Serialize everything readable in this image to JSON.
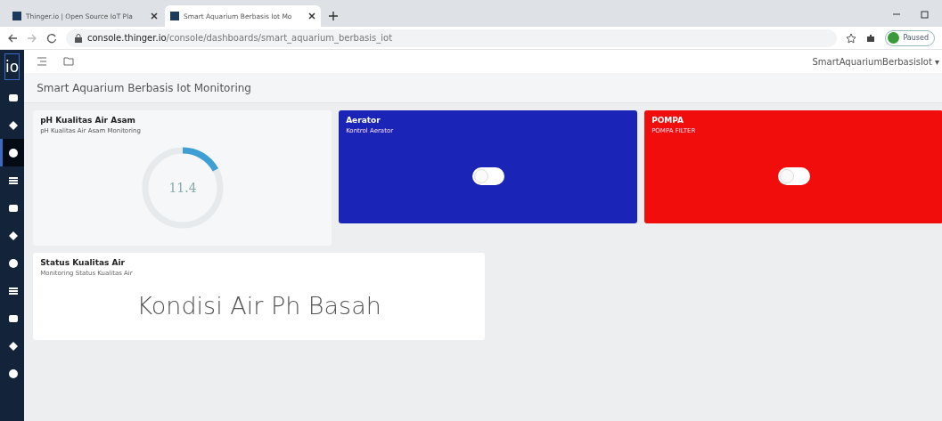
{
  "browser": {
    "tabs": [
      {
        "label": "Thinger.io | Open Source IoT Pla",
        "selected": false
      },
      {
        "label": "Smart Aquarium Berbasis Iot Mo",
        "selected": true
      }
    ],
    "url_host": "console.thinger.io",
    "url_path": "/console/dashboards/smart_aquarium_berbasis_iot",
    "profile_status": "Paused"
  },
  "app": {
    "logo": "io",
    "user": "SmartAquariumBerbasisIot",
    "user_caret": "▾",
    "dashboard_title": "Smart Aquarium Berbasis Iot Monitoring",
    "sidebar": [
      {
        "selected": false
      },
      {
        "selected": false
      },
      {
        "selected": true
      },
      {
        "selected": false
      },
      {
        "selected": false
      },
      {
        "selected": false
      },
      {
        "selected": false
      },
      {
        "selected": false
      },
      {
        "selected": false
      },
      {
        "selected": false
      },
      {
        "selected": false
      }
    ],
    "gauge": {
      "title": "pH Kualitas Air Asam",
      "subtitle": "pH Kualitas Air Asam Monitoring",
      "value": "11.4",
      "level": 0.17
    },
    "switches": [
      {
        "title": "Aerator",
        "subtitle": "Kontrol Aerator",
        "color": "#1a25b8",
        "on": false
      },
      {
        "title": "POMPA",
        "subtitle": "POMPA FILTER",
        "color": "#f20d0d",
        "on": false
      }
    ],
    "status": {
      "title": "Status Kualitas Air",
      "subtitle": "Monitoring Status Kualitas Air",
      "text": "Kondisi Air Ph Basah"
    }
  }
}
